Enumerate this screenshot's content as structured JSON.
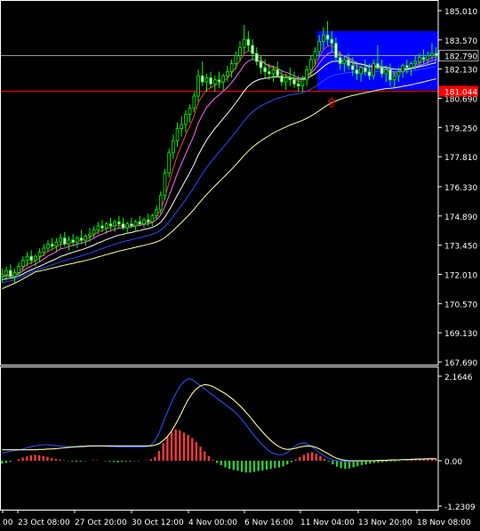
{
  "chart_data": [
    {
      "type": "candlestick",
      "title": "",
      "ylim": [
        167.0,
        186.0
      ],
      "y_ticks": [
        "185.010",
        "183.570",
        "182.130",
        "180.690",
        "179.250",
        "177.810",
        "176.330",
        "174.890",
        "173.450",
        "172.010",
        "170.570",
        "169.130",
        "167.690"
      ],
      "x_ticks": [
        "00",
        "23 Oct 08:00",
        "27 Oct 20:00",
        "30 Oct 12:00",
        "4 Nov 00:00",
        "6 Nov 16:00",
        "11 Nov 04:00",
        "13 Nov 20:00",
        "18 Nov 08:00"
      ],
      "current_price_label": "182.790",
      "current_price": 182.79,
      "horizontal_line_label": "181.044",
      "horizontal_line_price": 181.04,
      "range_box": {
        "low": 181.1,
        "high": 184.0,
        "from_bar": 76,
        "to_bar": 119,
        "color": "#0000ff"
      },
      "arrow": {
        "bar": 79,
        "price": 180.5,
        "color": "#ff0000"
      },
      "candles": [
        [
          171.9,
          172.3,
          171.6,
          172.0
        ],
        [
          172.0,
          172.4,
          171.7,
          172.2
        ],
        [
          172.2,
          172.5,
          171.8,
          171.9
        ],
        [
          171.9,
          172.3,
          171.6,
          172.1
        ],
        [
          172.1,
          172.6,
          171.9,
          172.4
        ],
        [
          172.4,
          172.9,
          172.2,
          172.7
        ],
        [
          172.7,
          173.1,
          172.4,
          172.9
        ],
        [
          172.9,
          173.2,
          172.5,
          172.7
        ],
        [
          172.7,
          173.0,
          172.4,
          172.9
        ],
        [
          172.9,
          173.3,
          172.6,
          173.1
        ],
        [
          173.1,
          173.5,
          172.9,
          173.3
        ],
        [
          173.3,
          173.7,
          173.1,
          173.5
        ],
        [
          173.5,
          173.8,
          173.2,
          173.4
        ],
        [
          173.4,
          173.8,
          173.1,
          173.6
        ],
        [
          173.6,
          174.0,
          173.3,
          173.8
        ],
        [
          173.8,
          174.1,
          173.4,
          173.5
        ],
        [
          173.5,
          173.9,
          173.2,
          173.7
        ],
        [
          173.7,
          174.0,
          173.4,
          173.6
        ],
        [
          173.6,
          173.9,
          173.3,
          173.8
        ],
        [
          173.8,
          174.2,
          173.5,
          173.7
        ],
        [
          173.7,
          174.0,
          173.4,
          173.9
        ],
        [
          173.9,
          174.3,
          173.6,
          174.0
        ],
        [
          174.0,
          174.4,
          173.8,
          174.2
        ],
        [
          174.2,
          174.6,
          174.0,
          174.4
        ],
        [
          174.4,
          174.7,
          174.1,
          174.3
        ],
        [
          174.3,
          174.6,
          174.0,
          174.5
        ],
        [
          174.5,
          174.8,
          174.2,
          174.4
        ],
        [
          174.4,
          174.7,
          174.1,
          174.6
        ],
        [
          174.6,
          174.9,
          174.3,
          174.5
        ],
        [
          174.5,
          174.8,
          174.2,
          174.3
        ],
        [
          174.3,
          174.6,
          174.0,
          174.5
        ],
        [
          174.5,
          174.8,
          174.3,
          174.4
        ],
        [
          174.4,
          174.7,
          174.1,
          174.6
        ],
        [
          174.6,
          174.9,
          174.4,
          174.5
        ],
        [
          174.5,
          174.8,
          174.3,
          174.7
        ],
        [
          174.7,
          175.0,
          174.4,
          174.6
        ],
        [
          174.6,
          175.0,
          174.4,
          174.9
        ],
        [
          174.9,
          175.4,
          174.7,
          175.2
        ],
        [
          175.2,
          176.1,
          175.0,
          175.9
        ],
        [
          175.9,
          177.2,
          175.7,
          177.0
        ],
        [
          177.0,
          178.2,
          176.8,
          178.0
        ],
        [
          178.0,
          178.9,
          177.7,
          178.6
        ],
        [
          178.6,
          179.5,
          178.3,
          179.2
        ],
        [
          179.2,
          179.8,
          178.8,
          179.4
        ],
        [
          179.4,
          180.1,
          179.0,
          179.9
        ],
        [
          179.9,
          180.4,
          179.5,
          180.2
        ],
        [
          180.2,
          181.0,
          180.0,
          180.8
        ],
        [
          180.8,
          182.1,
          180.5,
          181.8
        ],
        [
          181.8,
          182.5,
          181.3,
          181.5
        ],
        [
          181.5,
          181.9,
          181.0,
          181.7
        ],
        [
          181.7,
          182.0,
          181.2,
          181.4
        ],
        [
          181.4,
          181.8,
          181.0,
          181.6
        ],
        [
          181.6,
          182.0,
          181.2,
          181.5
        ],
        [
          181.5,
          181.9,
          181.1,
          181.8
        ],
        [
          181.8,
          182.3,
          181.5,
          182.0
        ],
        [
          182.0,
          182.6,
          181.7,
          182.4
        ],
        [
          182.4,
          183.0,
          182.1,
          182.8
        ],
        [
          182.8,
          183.5,
          182.5,
          183.2
        ],
        [
          183.2,
          184.3,
          182.9,
          183.6
        ],
        [
          183.6,
          184.0,
          183.0,
          183.3
        ],
        [
          183.3,
          183.6,
          182.6,
          182.9
        ],
        [
          182.9,
          183.2,
          182.3,
          182.5
        ],
        [
          182.5,
          182.8,
          181.9,
          182.2
        ],
        [
          182.2,
          182.6,
          181.7,
          182.0
        ],
        [
          182.0,
          182.4,
          181.6,
          181.9
        ],
        [
          181.9,
          182.3,
          181.5,
          182.1
        ],
        [
          182.1,
          182.5,
          181.7,
          181.8
        ],
        [
          181.8,
          182.1,
          181.3,
          181.5
        ],
        [
          181.5,
          181.9,
          181.1,
          181.7
        ],
        [
          181.7,
          182.2,
          181.3,
          181.6
        ],
        [
          181.6,
          182.0,
          181.2,
          181.4
        ],
        [
          181.4,
          181.8,
          181.0,
          181.3
        ],
        [
          181.3,
          181.8,
          181.0,
          181.6
        ],
        [
          181.6,
          182.3,
          181.3,
          182.1
        ],
        [
          182.1,
          182.8,
          181.8,
          182.6
        ],
        [
          182.6,
          183.2,
          182.3,
          183.0
        ],
        [
          183.0,
          183.8,
          182.7,
          183.5
        ],
        [
          183.5,
          184.2,
          183.1,
          183.8
        ],
        [
          183.8,
          184.5,
          183.3,
          183.6
        ],
        [
          183.6,
          184.0,
          183.0,
          183.4
        ],
        [
          183.4,
          183.7,
          182.5,
          182.7
        ],
        [
          182.7,
          183.0,
          182.1,
          182.4
        ],
        [
          182.4,
          182.8,
          182.0,
          182.6
        ],
        [
          182.6,
          182.9,
          182.1,
          182.3
        ],
        [
          182.3,
          182.7,
          181.8,
          182.1
        ],
        [
          182.1,
          182.5,
          181.6,
          181.9
        ],
        [
          181.9,
          182.3,
          181.5,
          182.2
        ],
        [
          182.2,
          182.6,
          181.8,
          182.0
        ],
        [
          182.0,
          182.4,
          181.6,
          181.8
        ],
        [
          181.8,
          182.6,
          181.6,
          182.4
        ],
        [
          182.4,
          183.3,
          182.1,
          182.2
        ],
        [
          182.2,
          182.6,
          181.7,
          181.9
        ],
        [
          181.9,
          182.3,
          181.5,
          182.1
        ],
        [
          182.1,
          182.4,
          181.3,
          181.6
        ],
        [
          181.6,
          182.0,
          181.2,
          181.8
        ],
        [
          181.8,
          182.2,
          181.5,
          182.0
        ],
        [
          182.0,
          182.4,
          181.7,
          182.3
        ],
        [
          182.3,
          182.6,
          181.9,
          182.2
        ],
        [
          182.2,
          182.5,
          181.8,
          182.4
        ],
        [
          182.4,
          182.8,
          182.1,
          182.5
        ],
        [
          182.5,
          182.9,
          182.2,
          182.7
        ],
        [
          182.7,
          183.1,
          182.4,
          182.6
        ],
        [
          182.6,
          183.0,
          182.3,
          182.8
        ],
        [
          182.8,
          183.4,
          182.6,
          182.9
        ],
        [
          182.9,
          183.2,
          182.5,
          182.79
        ]
      ],
      "series": [
        {
          "name": "",
          "color": "#ff3b3b",
          "values": []
        },
        {
          "name": "",
          "color": "#ff66ff",
          "values": []
        },
        {
          "name": "",
          "color": "#ffffff",
          "values": []
        },
        {
          "name": "",
          "color": "#2a4cff",
          "values": []
        },
        {
          "name": "",
          "color": "#ffff99",
          "values": []
        }
      ]
    },
    {
      "type": "oscillator",
      "ylim": [
        -1.5,
        2.4
      ],
      "y_ticks": [
        "2.1646",
        "0.00",
        "-1.2309"
      ],
      "histogram": [
        -0.08,
        -0.06,
        -0.03,
        0.0,
        0.04,
        0.08,
        0.11,
        0.14,
        0.15,
        0.14,
        0.12,
        0.1,
        0.07,
        0.05,
        0.03,
        0.01,
        -0.01,
        -0.02,
        -0.03,
        -0.02,
        -0.01,
        0.0,
        0.01,
        0.01,
        0.0,
        -0.01,
        -0.02,
        -0.03,
        -0.04,
        -0.03,
        -0.02,
        -0.02,
        -0.01,
        -0.01,
        0.0,
        0.01,
        0.04,
        0.1,
        0.25,
        0.45,
        0.62,
        0.74,
        0.8,
        0.78,
        0.72,
        0.66,
        0.58,
        0.48,
        0.36,
        0.24,
        0.12,
        0.02,
        -0.06,
        -0.12,
        -0.18,
        -0.22,
        -0.25,
        -0.27,
        -0.3,
        -0.32,
        -0.32,
        -0.3,
        -0.28,
        -0.26,
        -0.24,
        -0.22,
        -0.2,
        -0.18,
        -0.15,
        -0.1,
        -0.04,
        0.03,
        0.09,
        0.15,
        0.2,
        0.22,
        0.18,
        0.12,
        0.05,
        -0.02,
        -0.1,
        -0.16,
        -0.2,
        -0.22,
        -0.21,
        -0.18,
        -0.15,
        -0.12,
        -0.1,
        -0.08,
        -0.06,
        -0.05,
        -0.04,
        -0.03,
        -0.02,
        -0.02,
        -0.01,
        0.0,
        0.01,
        0.02,
        0.03,
        0.04,
        0.05,
        0.06,
        0.06,
        0.05
      ],
      "series": [
        {
          "name": "",
          "color": "#2a4cff",
          "values": [
            0.2,
            0.22,
            0.24,
            0.26,
            0.28,
            0.3,
            0.33,
            0.36,
            0.38,
            0.4,
            0.41,
            0.41,
            0.4,
            0.39,
            0.38,
            0.37,
            0.36,
            0.35,
            0.35,
            0.35,
            0.36,
            0.37,
            0.38,
            0.38,
            0.38,
            0.37,
            0.36,
            0.36,
            0.35,
            0.35,
            0.35,
            0.35,
            0.35,
            0.35,
            0.35,
            0.36,
            0.4,
            0.52,
            0.72,
            0.98,
            1.25,
            1.5,
            1.72,
            1.9,
            2.03,
            2.1,
            2.08,
            2.0,
            1.92,
            1.84,
            1.76,
            1.68,
            1.6,
            1.52,
            1.44,
            1.36,
            1.28,
            1.18,
            1.06,
            0.92,
            0.78,
            0.64,
            0.52,
            0.4,
            0.3,
            0.22,
            0.17,
            0.15,
            0.16,
            0.21,
            0.3,
            0.38,
            0.44,
            0.46,
            0.42,
            0.35,
            0.27,
            0.19,
            0.12,
            0.06,
            0.02,
            0.0,
            -0.01,
            -0.02,
            -0.02,
            -0.02,
            -0.01,
            -0.01,
            0.0,
            0.0,
            0.0,
            0.0,
            0.01,
            0.01,
            0.01,
            0.02,
            0.02,
            0.03,
            0.03,
            0.04,
            0.04,
            0.05,
            0.05,
            0.06,
            0.06,
            0.06
          ]
        },
        {
          "name": "",
          "color": "#ffff99",
          "values": [
            0.28,
            0.28,
            0.28,
            0.28,
            0.28,
            0.28,
            0.28,
            0.28,
            0.28,
            0.29,
            0.29,
            0.3,
            0.3,
            0.31,
            0.32,
            0.33,
            0.34,
            0.35,
            0.36,
            0.37,
            0.37,
            0.38,
            0.38,
            0.38,
            0.38,
            0.38,
            0.38,
            0.38,
            0.38,
            0.38,
            0.38,
            0.38,
            0.38,
            0.38,
            0.38,
            0.38,
            0.38,
            0.4,
            0.44,
            0.52,
            0.62,
            0.76,
            0.94,
            1.14,
            1.36,
            1.56,
            1.72,
            1.84,
            1.92,
            1.95,
            1.94,
            1.9,
            1.84,
            1.78,
            1.72,
            1.64,
            1.56,
            1.46,
            1.36,
            1.24,
            1.12,
            0.99,
            0.86,
            0.74,
            0.62,
            0.52,
            0.43,
            0.36,
            0.31,
            0.29,
            0.3,
            0.32,
            0.35,
            0.37,
            0.38,
            0.37,
            0.34,
            0.29,
            0.23,
            0.17,
            0.11,
            0.06,
            0.03,
            0.01,
            0.0,
            0.0,
            0.0,
            0.0,
            0.0,
            0.0,
            0.0,
            0.01,
            0.01,
            0.01,
            0.02,
            0.02,
            0.02,
            0.03,
            0.03,
            0.03,
            0.04,
            0.04,
            0.04,
            0.05,
            0.05,
            0.05
          ]
        }
      ]
    }
  ]
}
